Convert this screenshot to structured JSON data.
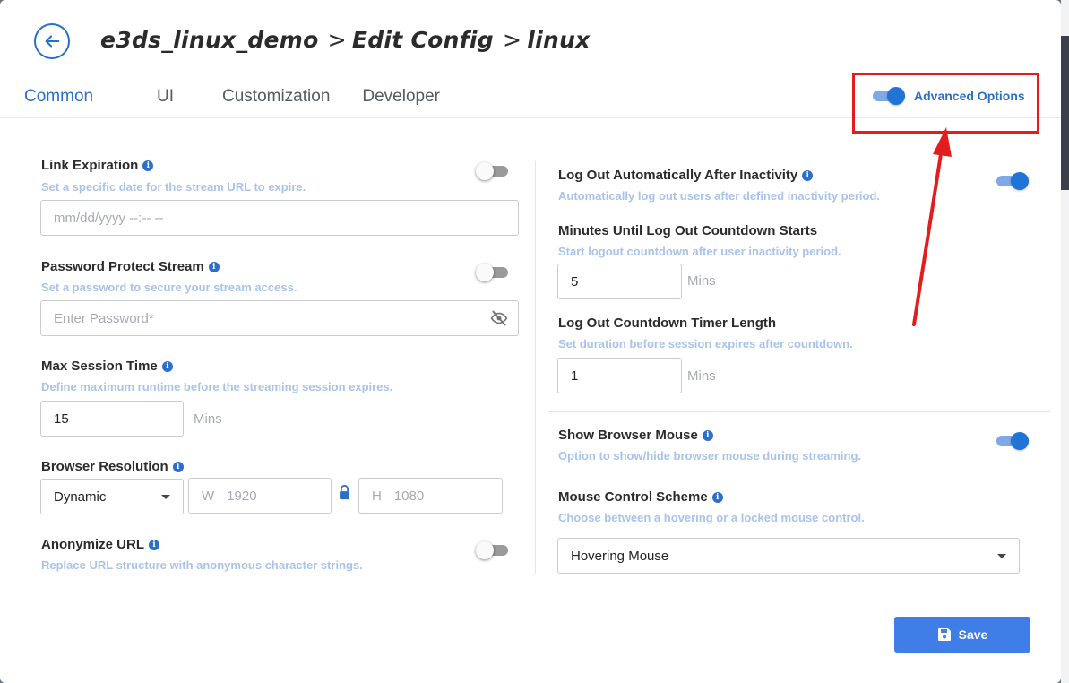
{
  "header": {
    "crumb1": "e3ds_linux_demo",
    "crumb2": "Edit Config",
    "crumb3": "linux",
    "separator": ">"
  },
  "tabs": [
    {
      "label": "Common",
      "active": true
    },
    {
      "label": "UI",
      "active": false
    },
    {
      "label": "Customization",
      "active": false
    },
    {
      "label": "Developer",
      "active": false
    }
  ],
  "advanced_options": {
    "label": "Advanced Options",
    "enabled": true
  },
  "left": {
    "link_expiration": {
      "label": "Link Expiration",
      "help": "Set a specific date for the stream URL to expire.",
      "enabled": false,
      "placeholder": "mm/dd/yyyy --:-- --"
    },
    "password_protect": {
      "label": "Password Protect Stream",
      "help": "Set a password to secure your stream access.",
      "enabled": false,
      "placeholder": "Enter Password*"
    },
    "max_session": {
      "label": "Max Session Time",
      "help": "Define maximum runtime before the streaming session expires.",
      "value": "15",
      "unit": "Mins"
    },
    "browser_resolution": {
      "label": "Browser Resolution",
      "mode": "Dynamic",
      "w_prefix": "W",
      "w_value": "1920",
      "h_prefix": "H",
      "h_value": "1080"
    },
    "anonymize_url": {
      "label": "Anonymize URL",
      "help": "Replace URL structure with anonymous character strings.",
      "enabled": false
    }
  },
  "right": {
    "logout_auto": {
      "label": "Log Out Automatically After Inactivity",
      "help": "Automatically log out users after defined inactivity period.",
      "enabled": true
    },
    "minutes_until": {
      "label": "Minutes Until Log Out Countdown Starts",
      "help": "Start logout countdown after user inactivity period.",
      "value": "5",
      "unit": "Mins"
    },
    "countdown_length": {
      "label": "Log Out Countdown Timer Length",
      "help": "Set duration before session expires after countdown.",
      "value": "1",
      "unit": "Mins"
    },
    "show_mouse": {
      "label": "Show Browser Mouse",
      "help": "Option to show/hide browser mouse during streaming.",
      "enabled": true
    },
    "mouse_scheme": {
      "label": "Mouse Control Scheme",
      "help": "Choose between a hovering or a locked mouse control.",
      "value": "Hovering Mouse"
    }
  },
  "footer": {
    "save_label": "Save"
  },
  "colors": {
    "accent": "#2a6fc9",
    "annotation": "#e31d1d",
    "save_button": "#3f7ee6"
  },
  "icons": [
    "back-arrow-icon",
    "info-icon",
    "eye-off-icon",
    "lock-icon",
    "save-icon",
    "chevron-down-icon"
  ]
}
